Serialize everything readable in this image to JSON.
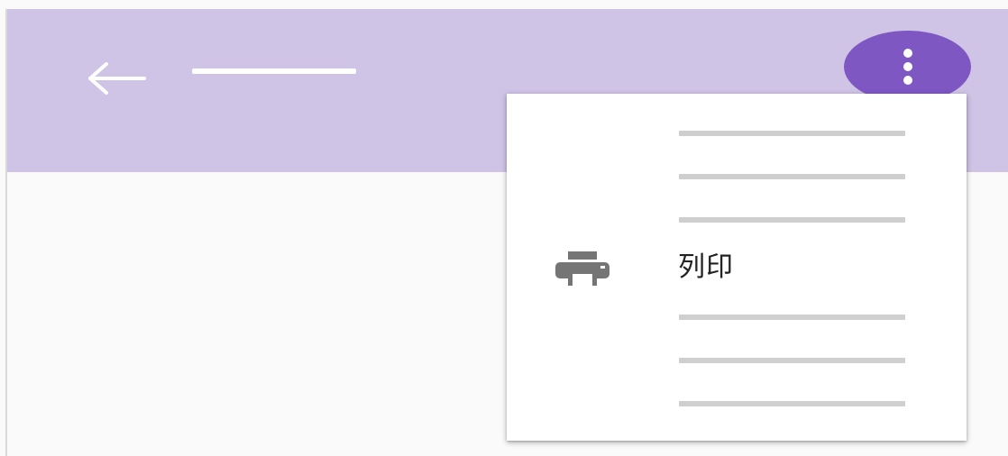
{
  "colors": {
    "app_bar": "#cfc3e6",
    "overflow_button": "#7e57c2",
    "page_background": "#fafafa",
    "menu_background": "#ffffff",
    "placeholder_line": "#cfcfcf",
    "icon_gray": "#757575"
  },
  "header": {
    "back_icon": "arrow-left-icon",
    "overflow_icon": "more-vert-icon"
  },
  "menu": {
    "print_item": {
      "icon": "printer-icon",
      "label": "列印"
    }
  }
}
